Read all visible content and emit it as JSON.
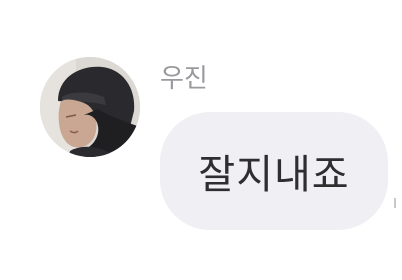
{
  "message": {
    "sender_name": "우진",
    "text": "잘지내죠",
    "avatar": "profile-photo"
  },
  "colors": {
    "background": "#ffffff",
    "bubble": "#efeff4",
    "sender_name": "#9a9a9e",
    "message_text": "#2e2e30"
  }
}
